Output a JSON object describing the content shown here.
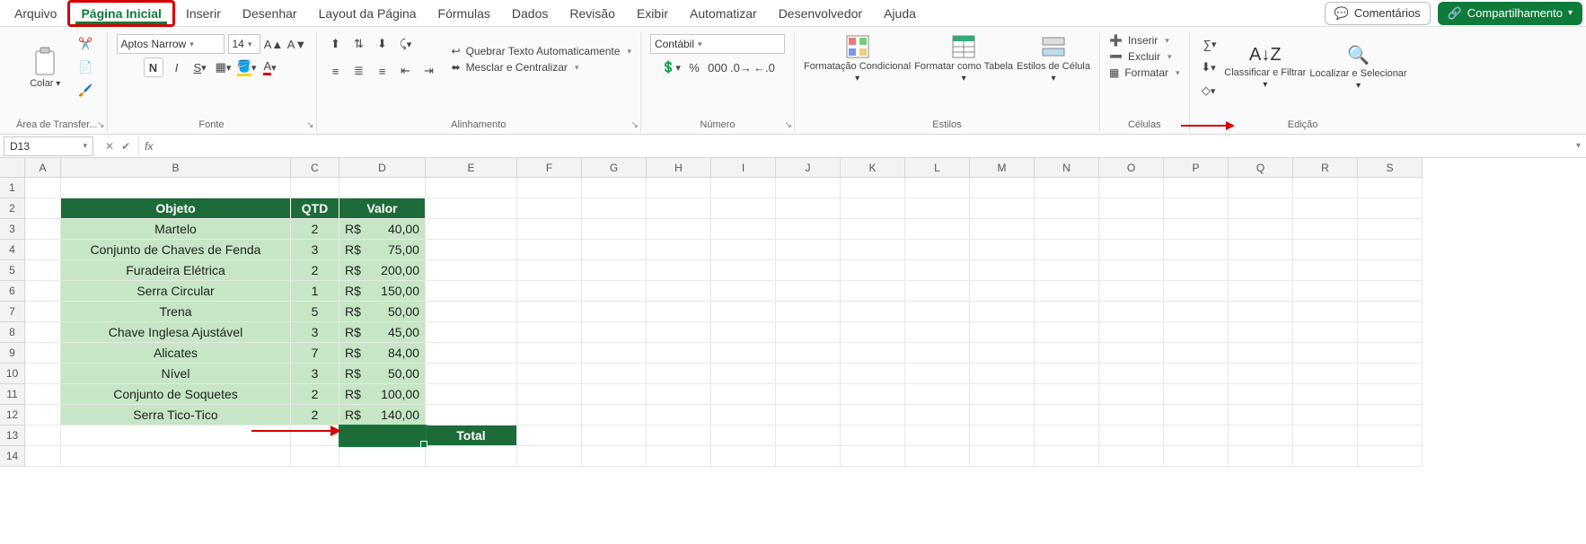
{
  "menu": {
    "items": [
      "Arquivo",
      "Página Inicial",
      "Inserir",
      "Desenhar",
      "Layout da Página",
      "Fórmulas",
      "Dados",
      "Revisão",
      "Exibir",
      "Automatizar",
      "Desenvolvedor",
      "Ajuda"
    ],
    "active_index": 1,
    "comments": "Comentários",
    "share": "Compartilhamento"
  },
  "ribbon": {
    "clipboard": {
      "paste": "Colar",
      "title": "Área de Transfer..."
    },
    "font": {
      "name": "Aptos Narrow",
      "size": "14",
      "title": "Fonte"
    },
    "alignment": {
      "wrap": "Quebrar Texto Automaticamente",
      "merge": "Mesclar e Centralizar",
      "title": "Alinhamento"
    },
    "number": {
      "format": "Contábil",
      "title": "Número"
    },
    "styles": {
      "cond": "Formatação Condicional",
      "table": "Formatar como Tabela",
      "cellstyles": "Estilos de Célula",
      "title": "Estilos"
    },
    "cells": {
      "insert": "Inserir",
      "delete": "Excluir",
      "format": "Formatar",
      "title": "Células"
    },
    "editing": {
      "sort": "Classificar e Filtrar",
      "find": "Localizar e Selecionar",
      "title": "Edição"
    }
  },
  "namebox": "D13",
  "formula": "",
  "columns": [
    "A",
    "B",
    "C",
    "D",
    "E",
    "F",
    "G",
    "H",
    "I",
    "J",
    "K",
    "L",
    "M",
    "N",
    "O",
    "P",
    "Q",
    "R",
    "S"
  ],
  "rownums": [
    "1",
    "2",
    "3",
    "4",
    "5",
    "6",
    "7",
    "8",
    "9",
    "10",
    "11",
    "12",
    "13",
    "14"
  ],
  "headers": {
    "b": "Objeto",
    "c": "QTD",
    "d": "Valor"
  },
  "data": [
    {
      "obj": "Martelo",
      "qtd": "2",
      "cur": "R$",
      "val": "40,00"
    },
    {
      "obj": "Conjunto de Chaves de Fenda",
      "qtd": "3",
      "cur": "R$",
      "val": "75,00"
    },
    {
      "obj": "Furadeira Elétrica",
      "qtd": "2",
      "cur": "R$",
      "val": "200,00"
    },
    {
      "obj": "Serra Circular",
      "qtd": "1",
      "cur": "R$",
      "val": "150,00"
    },
    {
      "obj": "Trena",
      "qtd": "5",
      "cur": "R$",
      "val": "50,00"
    },
    {
      "obj": "Chave Inglesa Ajustável",
      "qtd": "3",
      "cur": "R$",
      "val": "45,00"
    },
    {
      "obj": "Alicates",
      "qtd": "7",
      "cur": "R$",
      "val": "84,00"
    },
    {
      "obj": "Nível",
      "qtd": "3",
      "cur": "R$",
      "val": "50,00"
    },
    {
      "obj": "Conjunto de Soquetes",
      "qtd": "2",
      "cur": "R$",
      "val": "100,00"
    },
    {
      "obj": "Serra Tico-Tico",
      "qtd": "2",
      "cur": "R$",
      "val": "140,00"
    }
  ],
  "total_label": "Total"
}
